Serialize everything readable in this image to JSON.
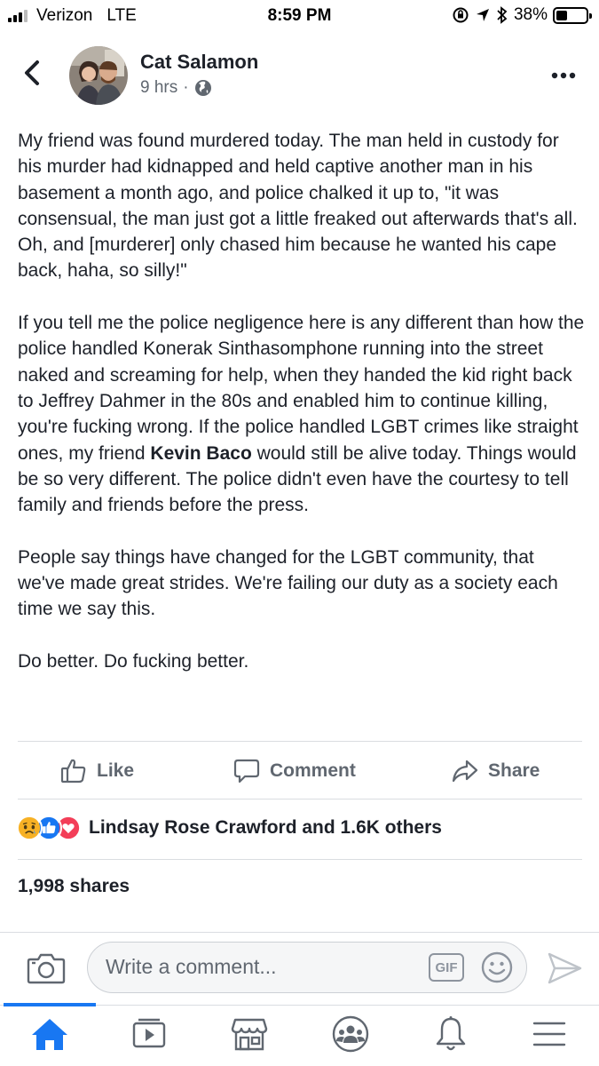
{
  "status_bar": {
    "carrier": "Verizon",
    "network": "LTE",
    "time": "8:59 PM",
    "battery_percent": "38%",
    "battery_level": 0.38,
    "signal_bars_filled": 3,
    "signal_bars_total": 4
  },
  "post": {
    "author": "Cat Salamon",
    "time_ago": "9 hrs",
    "meta_separator": "·",
    "privacy_icon": "globe-icon",
    "paragraphs": [
      "My friend was found murdered today. The man held in custody for his murder had kidnapped and held captive another man in his basement a month ago, and police chalked it up to, \"it was consensual, the man just got a little freaked out afterwards that's all. Oh, and [murderer] only chased him because he wanted his cape back, haha, so silly!\""
    ],
    "paragraph2_before": "If you tell me the police negligence here is any different than how the police handled Konerak Sinthasomphone running into the street naked and screaming for help, when they handed the kid right back to Jeffrey Dahmer in the 80s and enabled him to continue killing, you're fucking wrong. If the police handled LGBT crimes like straight ones, my friend ",
    "paragraph2_tag": "Kevin Baco",
    "paragraph2_after": " would still be alive today. Things would be so very different. The police didn't even have the courtesy to tell family and friends before the press.",
    "paragraph3": "People say things have changed for the LGBT community, that we've made great strides. We're failing our duty as a society each time we say this.",
    "paragraph4": "Do better. Do fucking better."
  },
  "actions": {
    "like": "Like",
    "comment": "Comment",
    "share": "Share"
  },
  "reactions": {
    "icons": [
      "sad-reaction-icon",
      "like-reaction-icon",
      "love-reaction-icon"
    ],
    "text": "Lindsay Rose Crawford and 1.6K others"
  },
  "shares": "1,998 shares",
  "comment_bar": {
    "placeholder": "Write a comment...",
    "gif_label": "GIF"
  },
  "bottom_nav": {
    "items": [
      "home-icon",
      "watch-icon",
      "marketplace-icon",
      "groups-icon",
      "notifications-icon",
      "menu-icon"
    ],
    "active": "home-icon"
  },
  "colors": {
    "text": "#1d2129",
    "secondary": "#606770",
    "accent": "#1877f2",
    "love": "#f33e58",
    "sad": "#f7b125"
  }
}
